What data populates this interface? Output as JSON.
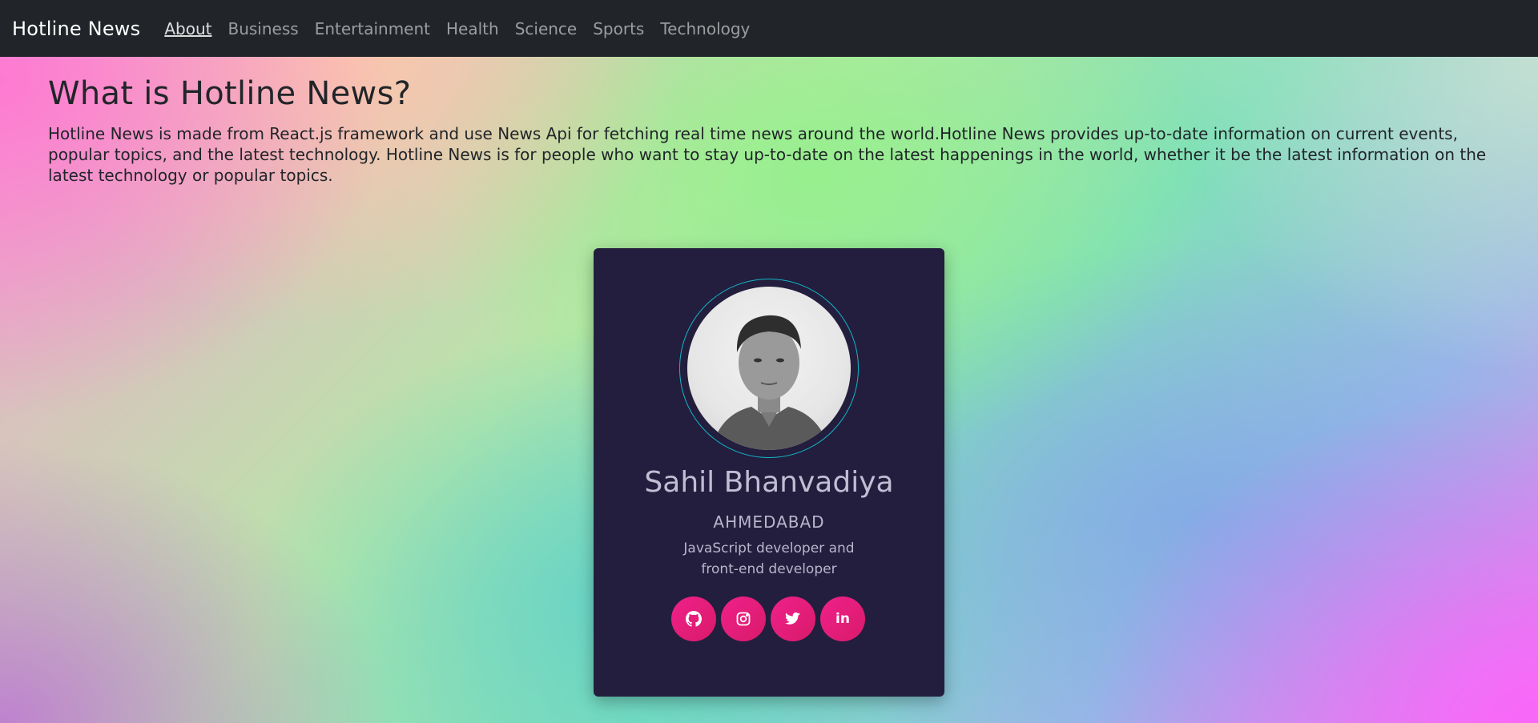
{
  "navbar": {
    "brand": "Hotline News",
    "links": [
      {
        "label": "About",
        "active": true
      },
      {
        "label": "Business"
      },
      {
        "label": "Entertainment"
      },
      {
        "label": "Health"
      },
      {
        "label": "Science"
      },
      {
        "label": "Sports"
      },
      {
        "label": "Technology"
      }
    ]
  },
  "about": {
    "heading": "What is Hotline News?",
    "description": "Hotline News is made from React.js framework and use News Api for fetching real time news around the world.Hotline News provides up-to-date information on current events, popular topics, and the latest technology. Hotline News is for people who want to stay up-to-date on the latest happenings in the world, whether it be the latest information on the latest technology or popular topics."
  },
  "profile": {
    "name": "Sahil Bhanvadiya",
    "city": "AHMEDABAD",
    "role": "JavaScript developer and front-end developer",
    "socials": [
      {
        "icon": "github-icon"
      },
      {
        "icon": "instagram-icon"
      },
      {
        "icon": "twitter-icon"
      },
      {
        "icon": "linkedin-icon",
        "text": "in"
      }
    ]
  },
  "colors": {
    "navbar_bg": "#212529",
    "card_bg": "#231e3d",
    "ring": "#12b5cb",
    "social_accent": "#f0208a"
  }
}
